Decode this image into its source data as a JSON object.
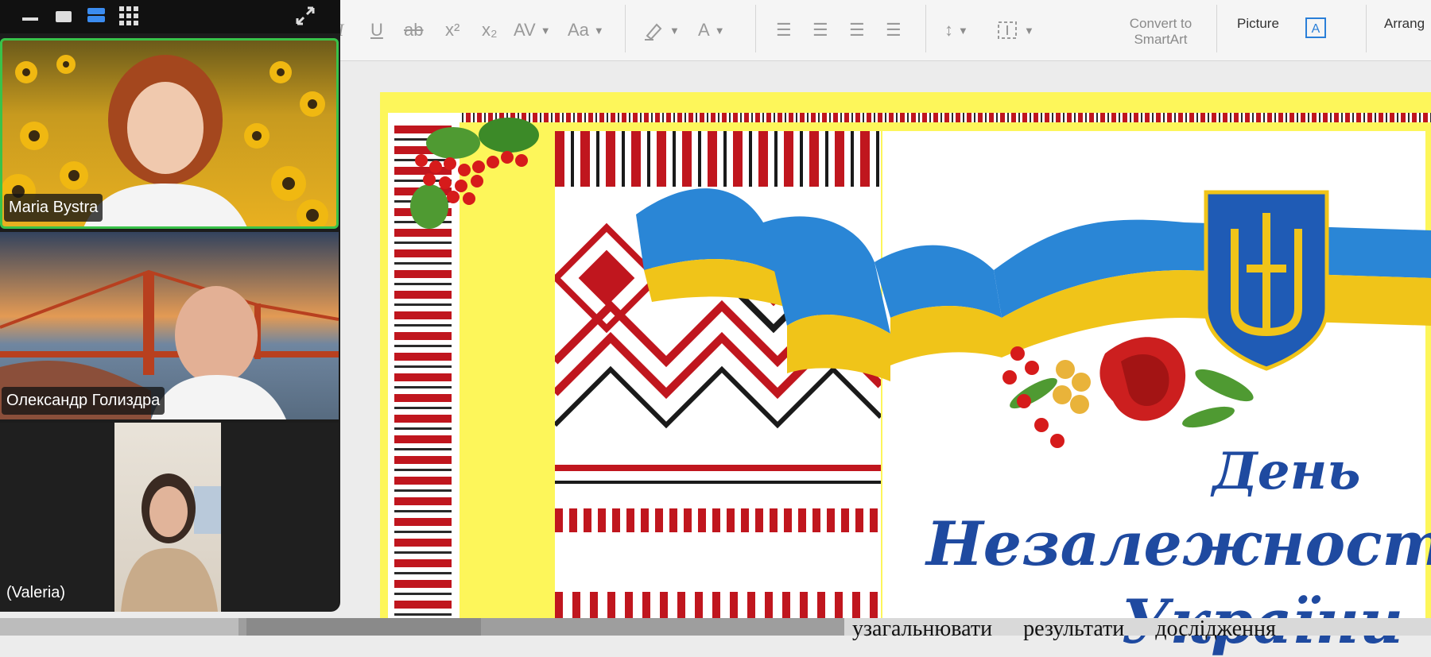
{
  "toolbar": {
    "format_buttons": [
      {
        "name": "italic",
        "glyph": "I"
      },
      {
        "name": "underline",
        "glyph": "U"
      },
      {
        "name": "strikethrough",
        "glyph": "ab"
      },
      {
        "name": "superscript",
        "glyph": "x²"
      },
      {
        "name": "subscript",
        "glyph": "x₂"
      },
      {
        "name": "character-spacing",
        "glyph": "AV"
      },
      {
        "name": "change-case",
        "glyph": "Aa"
      }
    ],
    "convert_to_smartart": "Convert to\nSmartArt",
    "picture_label": "Picture",
    "arrange_label": "Arrang"
  },
  "slide": {
    "title_line1": "День",
    "title_line2": "Незалежності",
    "title_line3": "України"
  },
  "participants": [
    {
      "name": "Maria Bystra",
      "active": true
    },
    {
      "name": "Олександр Голиздра",
      "active": false
    },
    {
      "name": "(Valeria)",
      "active": false
    }
  ],
  "document": {
    "text": "узагальнювати результати дослідження"
  },
  "colors": {
    "accent_blue": "#1f4aa0",
    "flag_blue": "#2a86d6",
    "flag_yellow": "#f0c419",
    "slide_yellow": "#fdf65a",
    "active_speaker": "#39c24a",
    "embroidery_red": "#c0161e"
  }
}
